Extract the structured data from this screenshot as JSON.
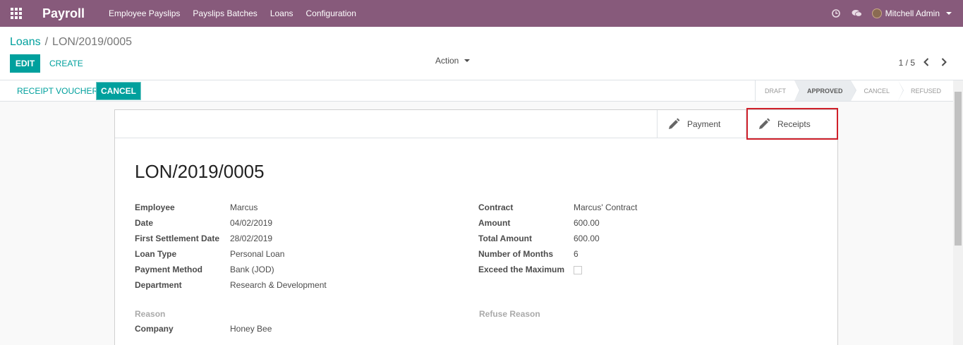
{
  "navbar": {
    "app_name": "Payroll",
    "menu": [
      "Employee Payslips",
      "Payslips Batches",
      "Loans",
      "Configuration"
    ],
    "user_name": "Mitchell Admin",
    "icons": [
      "apps-grid-icon",
      "clock-icon",
      "chat-icon",
      "avatar"
    ]
  },
  "breadcrumb": {
    "parent": "Loans",
    "separator": "/",
    "current": "LON/2019/0005"
  },
  "toolbar": {
    "edit_label": "EDIT",
    "create_label": "CREATE",
    "action_label": "Action",
    "pager": "1 / 5"
  },
  "statusbar": {
    "receipt_voucher_label": "RECEIPT VOUCHER",
    "cancel_label": "CANCEL",
    "stages": [
      "DRAFT",
      "APPROVED",
      "CANCEL",
      "REFUSED"
    ],
    "active_stage": "APPROVED"
  },
  "smart_buttons": {
    "payment_label": "Payment",
    "receipts_label": "Receipts"
  },
  "form": {
    "title": "LON/2019/0005",
    "left_fields": [
      {
        "label": "Employee",
        "value": "Marcus"
      },
      {
        "label": "Date",
        "value": "04/02/2019"
      },
      {
        "label": "First Settlement Date",
        "value": "28/02/2019"
      },
      {
        "label": "Loan Type",
        "value": "Personal Loan"
      },
      {
        "label": "Payment Method",
        "value": "Bank (JOD)"
      },
      {
        "label": "Department",
        "value": "Research & Development"
      }
    ],
    "right_fields": [
      {
        "label": "Contract",
        "value": "Marcus' Contract"
      },
      {
        "label": "Amount",
        "value": "600.00"
      },
      {
        "label": "Total Amount",
        "value": "600.00"
      },
      {
        "label": "Number of Months",
        "value": "6"
      },
      {
        "label": "Exceed the Maximum",
        "value": ""
      }
    ],
    "reason_label": "Reason",
    "refuse_reason_label": "Refuse Reason",
    "company_label": "Company",
    "company_value": "Honey Bee"
  },
  "colors": {
    "navbar": "#875a7b",
    "primary": "#00a09d",
    "highlight": "#d0202a"
  }
}
